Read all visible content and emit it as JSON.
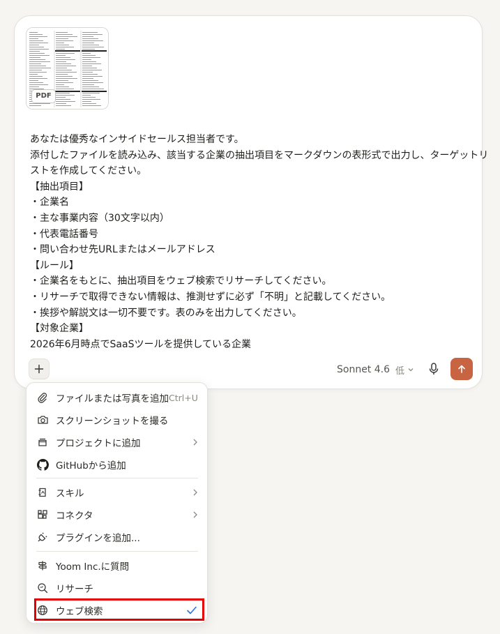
{
  "attachment": {
    "badge": "PDF"
  },
  "prompt": {
    "lines": [
      "あなたは優秀なインサイドセールス担当者です。",
      "添付したファイルを読み込み、該当する企業の抽出項目をマークダウンの表形式で出力し、ターゲットリ",
      "ストを作成してください。",
      "【抽出項目】",
      "・企業名",
      "・主な事業内容（30文字以内）",
      "・代表電話番号",
      "・問い合わせ先URLまたはメールアドレス",
      "【ルール】",
      "・企業名をもとに、抽出項目をウェブ検索でリサーチしてください。",
      "・リサーチで取得できない情報は、推測せずに必ず「不明」と記載してください。",
      "・挨拶や解説文は一切不要です。表のみを出力してください。",
      "【対象企業】",
      "2026年6月時点でSaaSツールを提供している企業"
    ]
  },
  "toolbar": {
    "model": "Sonnet 4.6",
    "effort": "低",
    "accent_color": "#c96442"
  },
  "menu": {
    "items": [
      {
        "label": "ファイルまたは写真を追加",
        "shortcut": "Ctrl+U",
        "icon": "paperclip-icon"
      },
      {
        "label": "スクリーンショットを撮る",
        "icon": "camera-icon"
      },
      {
        "label": "プロジェクトに追加",
        "icon": "folder-icon"
      },
      {
        "label": "GitHubから追加",
        "icon": "github-icon"
      },
      {
        "label": "スキル",
        "icon": "skill-icon"
      },
      {
        "label": "コネクタ",
        "icon": "connector-icon"
      },
      {
        "label": "プラグインを追加...",
        "icon": "plug-icon"
      },
      {
        "label": "Yoom Inc.に質問",
        "icon": "signpost-icon"
      },
      {
        "label": "リサーチ",
        "icon": "research-icon"
      },
      {
        "label": "ウェブ検索",
        "icon": "globe-icon",
        "checked": true
      }
    ],
    "highlight_color": "#e40000",
    "check_color": "#2f6fd6"
  }
}
